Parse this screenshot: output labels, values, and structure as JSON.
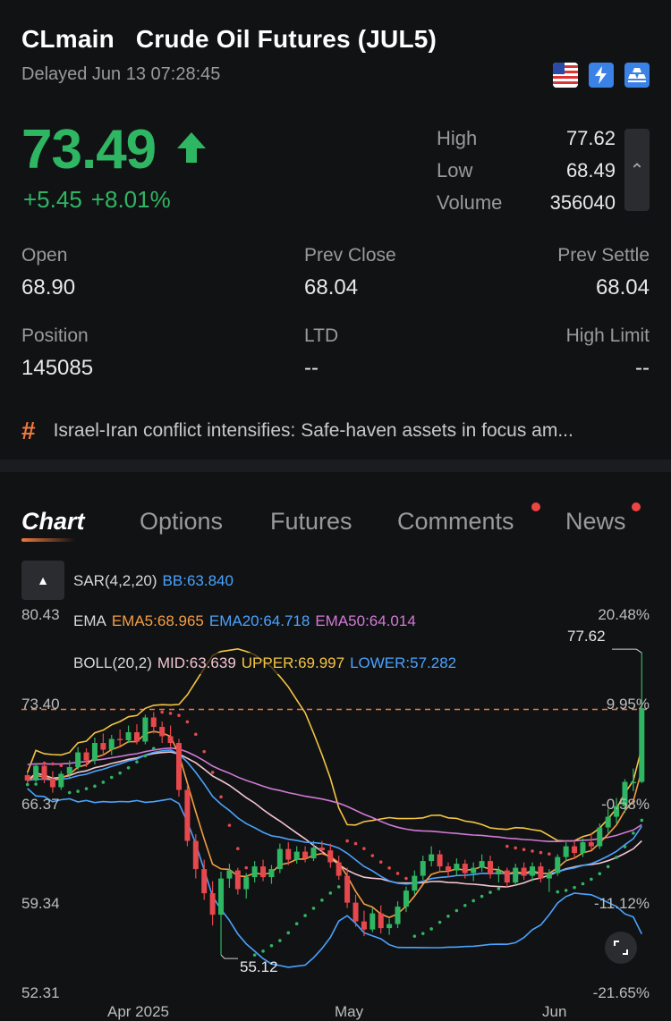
{
  "header": {
    "symbol": "CLmain",
    "name": "Crude Oil Futures (JUL5)",
    "status": "Delayed Jun 13 07:28:45",
    "badges": [
      "us-flag-icon",
      "lightning-icon",
      "gold-bars-icon"
    ]
  },
  "quote": {
    "price": "73.49",
    "change": "+5.45",
    "change_pct": "+8.01%",
    "direction": "up",
    "color_up": "#2fb663"
  },
  "summary": {
    "high_label": "High",
    "high": "77.62",
    "low_label": "Low",
    "low": "68.49",
    "volume_label": "Volume",
    "volume": "356040"
  },
  "details": {
    "open_label": "Open",
    "open": "68.90",
    "prev_close_label": "Prev Close",
    "prev_close": "68.04",
    "prev_settle_label": "Prev Settle",
    "prev_settle": "68.04",
    "position_label": "Position",
    "position": "145085",
    "ltd_label": "LTD",
    "ltd": "--",
    "high_limit_label": "High Limit",
    "high_limit": "--"
  },
  "news_headline": "Israel-Iran conflict intensifies: Safe-haven assets in focus am...",
  "tabs": [
    {
      "label": "Chart",
      "active": true
    },
    {
      "label": "Options"
    },
    {
      "label": "Futures"
    },
    {
      "label": "Comments",
      "dot": true
    },
    {
      "label": "News",
      "dot": true
    }
  ],
  "indicators": {
    "sar_label": "SAR(4,2,20)",
    "bb_label": "BB:63.840",
    "ema_label": "EMA",
    "ema5": "EMA5:68.965",
    "ema20": "EMA20:64.718",
    "ema50": "EMA50:64.014",
    "boll_label": "BOLL(20,2)",
    "boll_mid": "MID:63.639",
    "boll_upper": "UPPER:69.997",
    "boll_lower": "LOWER:57.282",
    "colors": {
      "sar": "#ef4444",
      "bb": "#4aa3ff",
      "ema5": "#f59e42",
      "ema20": "#4aa3ff",
      "ema50": "#d17ad6",
      "mid": "#f3c6cf",
      "upper": "#f5c542",
      "lower": "#4aa3ff"
    }
  },
  "chart_axis": {
    "y_labels": [
      "80.43",
      "73.40",
      "66.37",
      "59.34",
      "52.31"
    ],
    "pct_labels": [
      "20.48%",
      "9.95%",
      "-0.58%",
      "-11.12%",
      "-21.65%"
    ],
    "x_labels": [
      "Apr 2025",
      "May",
      "Jun"
    ],
    "high_marker": "77.62",
    "low_marker": "55.12"
  },
  "chart_data": {
    "type": "candlestick",
    "ylim": [
      52.31,
      80.43
    ],
    "reference_line": 73.4,
    "candles": [
      [
        68.5,
        68.7,
        67.8,
        68.1
      ],
      [
        68.1,
        69.4,
        68,
        69.2
      ],
      [
        69.2,
        69.5,
        67.9,
        68.2
      ],
      [
        68.2,
        68.8,
        67.2,
        67.6
      ],
      [
        67.6,
        68.8,
        67.4,
        68.6
      ],
      [
        68.6,
        69.6,
        68.2,
        69.1
      ],
      [
        69.1,
        70.6,
        68.9,
        70.2
      ],
      [
        70.2,
        70.5,
        69.1,
        69.6
      ],
      [
        69.6,
        71.3,
        69.3,
        70.9
      ],
      [
        70.9,
        71.6,
        70.0,
        70.4
      ],
      [
        70.4,
        71.5,
        70.0,
        71.2
      ],
      [
        71.2,
        71.9,
        70.7,
        71.1
      ],
      [
        71.1,
        72.2,
        70.9,
        71.7
      ],
      [
        71.7,
        72.3,
        70.8,
        71.0
      ],
      [
        71.0,
        73.0,
        70.8,
        72.8
      ],
      [
        72.8,
        73.2,
        71.6,
        72.1
      ],
      [
        72.1,
        72.5,
        70.9,
        71.4
      ],
      [
        71.4,
        72.2,
        70.6,
        70.9
      ],
      [
        70.9,
        71.2,
        66.9,
        67.4
      ],
      [
        67.4,
        67.8,
        63.2,
        63.6
      ],
      [
        63.6,
        64.1,
        60.8,
        61.5
      ],
      [
        61.5,
        62.2,
        59.2,
        59.7
      ],
      [
        59.7,
        60.6,
        57.3,
        58.1
      ],
      [
        58.1,
        61.3,
        55.1,
        60.8
      ],
      [
        60.8,
        61.9,
        60.1,
        61.4
      ],
      [
        61.4,
        61.6,
        59.6,
        60.0
      ],
      [
        60.0,
        61.2,
        59.3,
        60.9
      ],
      [
        60.9,
        62.1,
        60.5,
        61.7
      ],
      [
        61.7,
        62.2,
        60.6,
        60.9
      ],
      [
        60.9,
        61.8,
        60.4,
        61.5
      ],
      [
        61.5,
        63.4,
        61.2,
        63.0
      ],
      [
        63.0,
        63.5,
        61.8,
        62.2
      ],
      [
        62.2,
        63.2,
        61.9,
        62.8
      ],
      [
        62.8,
        63.2,
        62.0,
        62.3
      ],
      [
        62.3,
        63.6,
        62.1,
        63.1
      ],
      [
        63.1,
        63.6,
        62.6,
        62.9
      ],
      [
        62.9,
        63.4,
        61.6,
        62.0
      ],
      [
        62.0,
        62.5,
        60.7,
        61.0
      ],
      [
        61.0,
        61.6,
        58.6,
        59.0
      ],
      [
        59.0,
        59.6,
        57.2,
        57.6
      ],
      [
        57.6,
        58.4,
        56.5,
        57.0
      ],
      [
        57.0,
        58.6,
        56.8,
        58.2
      ],
      [
        58.2,
        58.8,
        56.7,
        57.1
      ],
      [
        57.1,
        57.8,
        56.6,
        57.4
      ],
      [
        57.4,
        59.1,
        57.1,
        58.7
      ],
      [
        58.7,
        60.2,
        58.3,
        59.9
      ],
      [
        59.9,
        61.4,
        59.6,
        61.0
      ],
      [
        61.0,
        62.5,
        60.7,
        62.1
      ],
      [
        62.1,
        63.2,
        61.7,
        62.6
      ],
      [
        62.6,
        62.9,
        61.3,
        61.7
      ],
      [
        61.7,
        62.0,
        60.9,
        61.4
      ],
      [
        61.4,
        62.3,
        61.0,
        61.9
      ],
      [
        61.9,
        62.2,
        60.8,
        61.2
      ],
      [
        61.2,
        62.0,
        60.6,
        61.6
      ],
      [
        61.6,
        62.6,
        61.3,
        62.1
      ],
      [
        62.1,
        62.5,
        60.8,
        61.1
      ],
      [
        61.1,
        61.7,
        60.5,
        61.4
      ],
      [
        61.4,
        61.6,
        60.1,
        60.5
      ],
      [
        60.5,
        61.9,
        60.3,
        61.6
      ],
      [
        61.6,
        62.0,
        60.7,
        61.0
      ],
      [
        61.0,
        62.0,
        60.6,
        61.7
      ],
      [
        61.7,
        62.0,
        60.5,
        60.8
      ],
      [
        60.8,
        61.5,
        59.8,
        61.2
      ],
      [
        61.2,
        62.6,
        61.0,
        62.4
      ],
      [
        62.4,
        63.5,
        62.1,
        63.2
      ],
      [
        63.2,
        63.6,
        62.3,
        62.7
      ],
      [
        62.7,
        63.8,
        62.4,
        63.5
      ],
      [
        63.5,
        64.2,
        62.9,
        63.2
      ],
      [
        63.2,
        64.9,
        63.0,
        64.6
      ],
      [
        64.6,
        66.0,
        64.2,
        65.4
      ],
      [
        65.4,
        66.8,
        64.9,
        66.2
      ],
      [
        66.2,
        68.2,
        65.7,
        68.0
      ],
      [
        68.0,
        69.0,
        67.3,
        68.0
      ],
      [
        68.0,
        77.62,
        67.9,
        73.49
      ]
    ],
    "x": [
      "Apr 2025",
      "May",
      "Jun"
    ]
  }
}
